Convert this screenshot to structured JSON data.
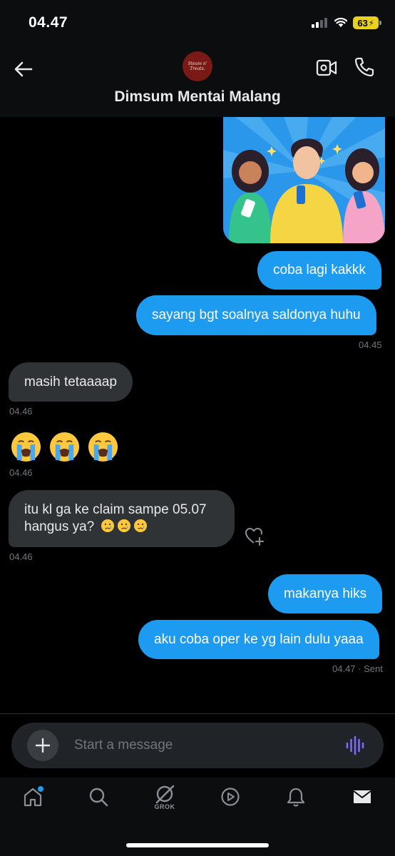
{
  "status_bar": {
    "time": "04.47",
    "battery": "63"
  },
  "header": {
    "title": "Dimsum Mentai Malang",
    "avatar_text": "Steam n' Treats."
  },
  "messages": [
    {
      "text": "coba lagi kakkk"
    },
    {
      "text": "sayang bgt soalnya saldonya huhu"
    },
    {
      "timestamp": "04.45"
    },
    {
      "text": "masih tetaaaap"
    },
    {
      "timestamp": "04.46"
    },
    {
      "emoji": "😭😭😭"
    },
    {
      "timestamp": "04.46"
    },
    {
      "line1": "itu kl ga ke claim sampe 05.07",
      "line2": "hangus ya?"
    },
    {
      "timestamp": "04.46"
    },
    {
      "text": "makanya hiks"
    },
    {
      "text": "aku coba oper ke yg lain dulu yaaa"
    },
    {
      "timestamp": "04.47 · Sent"
    }
  ],
  "composer": {
    "placeholder": "Start a message"
  },
  "nav": {
    "grok_label": "GROK"
  },
  "colors": {
    "accent": "#1d9bf0",
    "incoming_bubble": "#2f3336",
    "background": "#000000",
    "voice_icon": "#7c6cf2"
  },
  "icons": [
    "back-arrow-icon",
    "video-call-icon",
    "phone-icon",
    "plus-icon",
    "voice-wave-icon",
    "home-icon",
    "search-icon",
    "grok-icon",
    "play-icon",
    "bell-icon",
    "mail-icon",
    "heart-plus-icon",
    "loudly-crying-face-emoji",
    "crying-face-emoji"
  ]
}
